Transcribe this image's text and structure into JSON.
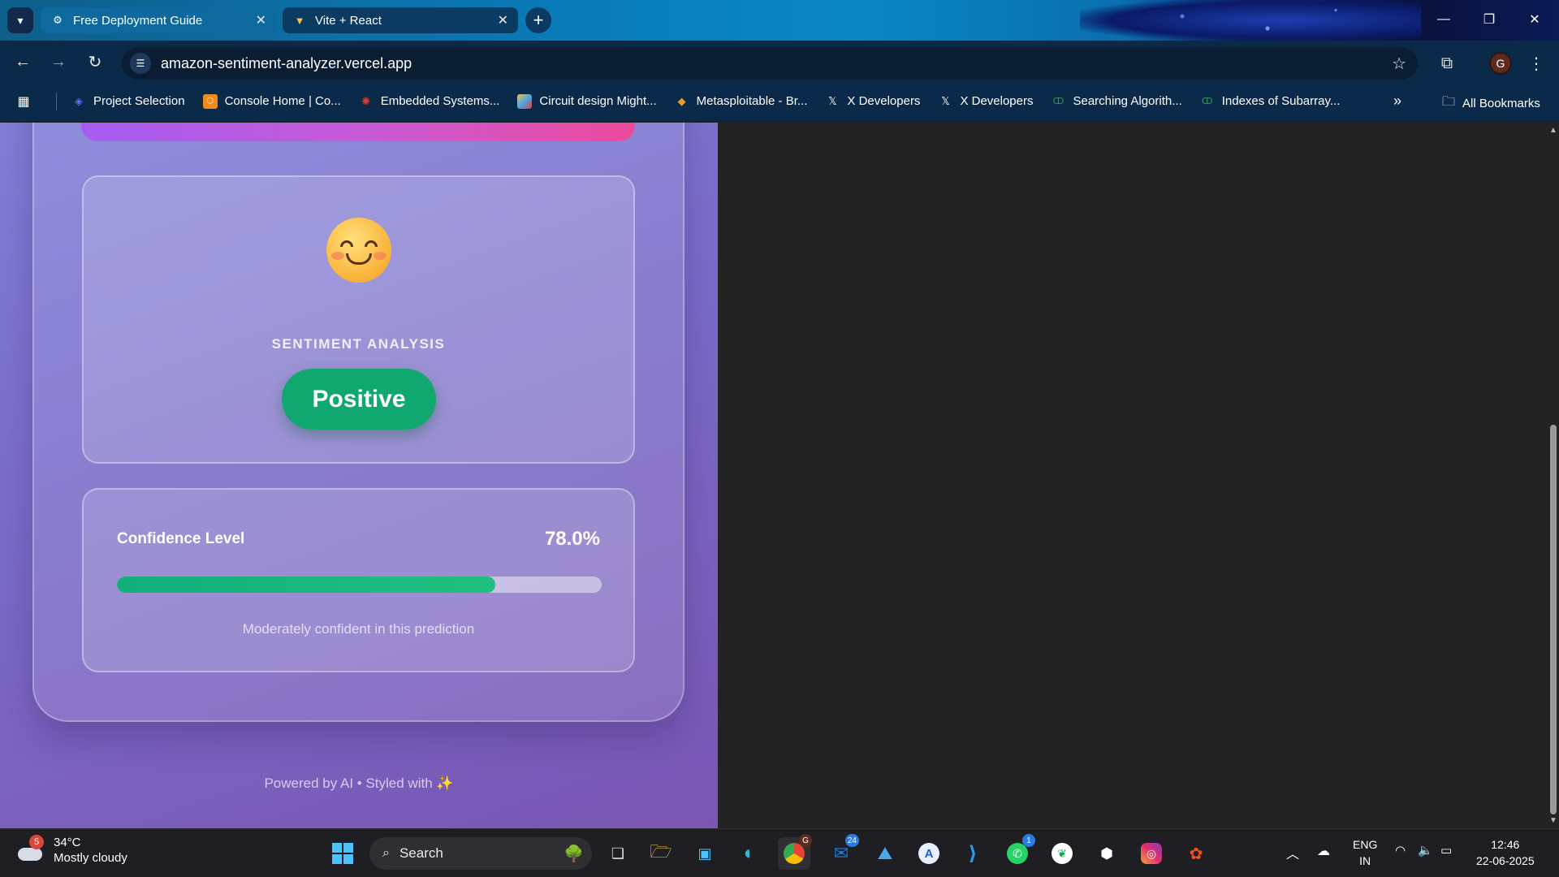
{
  "browser": {
    "tabs": [
      {
        "title": "Free Deployment Guide",
        "active": false
      },
      {
        "title": "Vite + React",
        "active": true
      }
    ],
    "url": "amazon-sentiment-analyzer.vercel.app",
    "profile_initial": "G",
    "bookmarks": [
      {
        "label": "Project Selection",
        "icon": "layers-icon",
        "color": "#6b6cf5"
      },
      {
        "label": "Console Home | Co...",
        "icon": "aws-icon",
        "color": "#f08a1c"
      },
      {
        "label": "Embedded Systems...",
        "icon": "gear-icon",
        "color": "#e0413a"
      },
      {
        "label": "Circuit design Might...",
        "icon": "grid-icon",
        "color": "#4aa6e8"
      },
      {
        "label": "Metasploitable - Br...",
        "icon": "diamond-icon",
        "color": "#f09a2a"
      },
      {
        "label": "X Developers",
        "icon": "x-icon",
        "color": "#ffffff"
      },
      {
        "label": "X Developers",
        "icon": "x-icon",
        "color": "#ffffff"
      },
      {
        "label": "Searching Algorith...",
        "icon": "gfg-icon",
        "color": "#2f9e4f"
      },
      {
        "label": "Indexes of Subarray...",
        "icon": "gfg-icon",
        "color": "#2f9e4f"
      }
    ],
    "all_bookmarks_label": "All Bookmarks"
  },
  "app": {
    "sentiment_heading": "SENTIMENT ANALYSIS",
    "sentiment_result": "Positive",
    "confidence_label": "Confidence Level",
    "confidence_value": "78.0%",
    "confidence_fraction": 0.78,
    "confidence_note": "Moderately confident in this prediction",
    "footer": "Powered by AI • Styled with ✨",
    "colors": {
      "positive": "#10a86e",
      "accent_bar": "#c65ad8"
    }
  },
  "taskbar": {
    "weather_temp": "34°C",
    "weather_desc": "Mostly cloudy",
    "weather_badge": "5",
    "search_placeholder": "Search",
    "outlook_badge": "24",
    "whatsapp_badge": "1",
    "chrome_badge": "G",
    "language": "ENG",
    "region": "IN",
    "time": "12:46",
    "date": "22-06-2025"
  }
}
